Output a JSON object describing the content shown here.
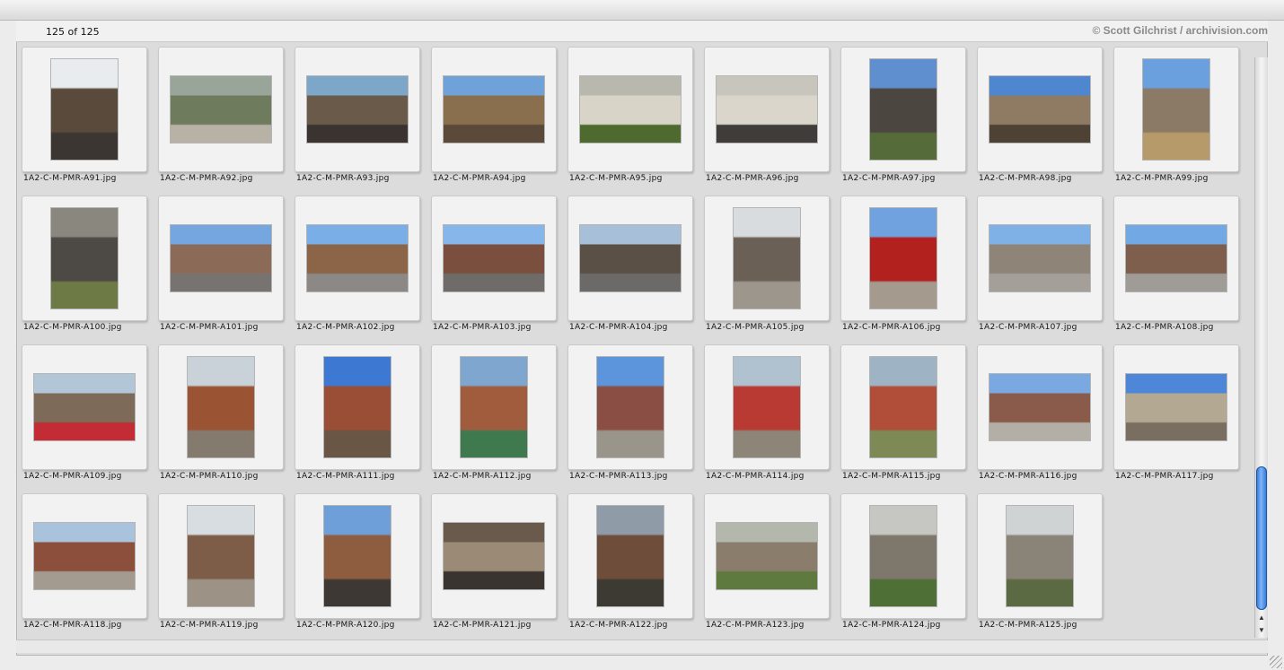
{
  "header": {
    "count": "125 of 125",
    "copyright": "© Scott Gilchrist / archivision.com"
  },
  "thumbnails": [
    {
      "name": "1A2-C-M-PMR-A91.jpg",
      "orient": "port",
      "sky": "#e9ecee",
      "wall": "#5a4a3c",
      "ground": "#3b3632"
    },
    {
      "name": "1A2-C-M-PMR-A92.jpg",
      "orient": "land",
      "sky": "#9aa59a",
      "wall": "#6e7b5c",
      "ground": "#b8b2a6"
    },
    {
      "name": "1A2-C-M-PMR-A93.jpg",
      "orient": "land",
      "sky": "#7da7c9",
      "wall": "#6a5a4a",
      "ground": "#3a3330"
    },
    {
      "name": "1A2-C-M-PMR-A94.jpg",
      "orient": "land",
      "sky": "#6fa2d8",
      "wall": "#8a6f4e",
      "ground": "#5b4a3a"
    },
    {
      "name": "1A2-C-M-PMR-A95.jpg",
      "orient": "land",
      "sky": "#b8b8ae",
      "wall": "#d9d4c8",
      "ground": "#4f6a2f"
    },
    {
      "name": "1A2-C-M-PMR-A96.jpg",
      "orient": "land",
      "sky": "#c8c5bd",
      "wall": "#dad6cc",
      "ground": "#3f3c39"
    },
    {
      "name": "1A2-C-M-PMR-A97.jpg",
      "orient": "port",
      "sky": "#5f8fcf",
      "wall": "#4b4640",
      "ground": "#556b39"
    },
    {
      "name": "1A2-C-M-PMR-A98.jpg",
      "orient": "land",
      "sky": "#4e86d0",
      "wall": "#8f7b63",
      "ground": "#4e4235"
    },
    {
      "name": "1A2-C-M-PMR-A99.jpg",
      "orient": "port",
      "sky": "#6aa0de",
      "wall": "#8a7a66",
      "ground": "#b79a6a"
    },
    {
      "name": "1A2-C-M-PMR-A100.jpg",
      "orient": "port",
      "sky": "#8a877f",
      "wall": "#4d4944",
      "ground": "#6e7a46"
    },
    {
      "name": "1A2-C-M-PMR-A101.jpg",
      "orient": "land",
      "sky": "#76a6e0",
      "wall": "#8b6a58",
      "ground": "#777370"
    },
    {
      "name": "1A2-C-M-PMR-A102.jpg",
      "orient": "land",
      "sky": "#7aaee6",
      "wall": "#8c6447",
      "ground": "#8b8885"
    },
    {
      "name": "1A2-C-M-PMR-A103.jpg",
      "orient": "land",
      "sky": "#86b6ea",
      "wall": "#7a4f3e",
      "ground": "#6e6b69"
    },
    {
      "name": "1A2-C-M-PMR-A104.jpg",
      "orient": "land",
      "sky": "#a7bfd8",
      "wall": "#5a5046",
      "ground": "#6c6a69"
    },
    {
      "name": "1A2-C-M-PMR-A105.jpg",
      "orient": "port",
      "sky": "#d8dcdf",
      "wall": "#6b6055",
      "ground": "#9d968c"
    },
    {
      "name": "1A2-C-M-PMR-A106.jpg",
      "orient": "port",
      "sky": "#6fa2de",
      "wall": "#b3211f",
      "ground": "#a49a8e"
    },
    {
      "name": "1A2-C-M-PMR-A107.jpg",
      "orient": "land",
      "sky": "#80b1e6",
      "wall": "#8e8478",
      "ground": "#a4a099"
    },
    {
      "name": "1A2-C-M-PMR-A108.jpg",
      "orient": "land",
      "sky": "#72a8e4",
      "wall": "#7e5f4e",
      "ground": "#9f9b96"
    },
    {
      "name": "1A2-C-M-PMR-A109.jpg",
      "orient": "land",
      "sky": "#b3c6d8",
      "wall": "#7d6a58",
      "ground": "#c32c34"
    },
    {
      "name": "1A2-C-M-PMR-A110.jpg",
      "orient": "port",
      "sky": "#c9d2d9",
      "wall": "#9a5433",
      "ground": "#857a6e"
    },
    {
      "name": "1A2-C-M-PMR-A111.jpg",
      "orient": "port",
      "sky": "#3d79d2",
      "wall": "#9b4e36",
      "ground": "#6a5644"
    },
    {
      "name": "1A2-C-M-PMR-A112.jpg",
      "orient": "port",
      "sky": "#7ea6cf",
      "wall": "#a05c3d",
      "ground": "#3f7a4f"
    },
    {
      "name": "1A2-C-M-PMR-A113.jpg",
      "orient": "port",
      "sky": "#5c95dc",
      "wall": "#8b4e44",
      "ground": "#9a958b"
    },
    {
      "name": "1A2-C-M-PMR-A114.jpg",
      "orient": "port",
      "sky": "#b0c1cf",
      "wall": "#b83a32",
      "ground": "#8d8678"
    },
    {
      "name": "1A2-C-M-PMR-A115.jpg",
      "orient": "port",
      "sky": "#9eb3c4",
      "wall": "#b04e3a",
      "ground": "#7d8a56"
    },
    {
      "name": "1A2-C-M-PMR-A116.jpg",
      "orient": "land",
      "sky": "#7aa8e0",
      "wall": "#8a5a4a",
      "ground": "#b3aea6"
    },
    {
      "name": "1A2-C-M-PMR-A117.jpg",
      "orient": "land",
      "sky": "#4e86d8",
      "wall": "#b3a892",
      "ground": "#7a6e60"
    },
    {
      "name": "1A2-C-M-PMR-A118.jpg",
      "orient": "land",
      "sky": "#a9c3dd",
      "wall": "#8c4f3c",
      "ground": "#a39b90"
    },
    {
      "name": "1A2-C-M-PMR-A119.jpg",
      "orient": "port",
      "sky": "#d7dde1",
      "wall": "#7d5d48",
      "ground": "#9c9386"
    },
    {
      "name": "1A2-C-M-PMR-A120.jpg",
      "orient": "port",
      "sky": "#6f9fd8",
      "wall": "#8e5d3f",
      "ground": "#3d3833"
    },
    {
      "name": "1A2-C-M-PMR-A121.jpg",
      "orient": "land",
      "sky": "#6a5a4c",
      "wall": "#9a8a76",
      "ground": "#3a3430"
    },
    {
      "name": "1A2-C-M-PMR-A122.jpg",
      "orient": "port",
      "sky": "#8f9ca8",
      "wall": "#6e4d3b",
      "ground": "#3c3a33"
    },
    {
      "name": "1A2-C-M-PMR-A123.jpg",
      "orient": "land",
      "sky": "#b4b8ac",
      "wall": "#8b7d6c",
      "ground": "#5f7a3f"
    },
    {
      "name": "1A2-C-M-PMR-A124.jpg",
      "orient": "port",
      "sky": "#c6c7c2",
      "wall": "#7e776c",
      "ground": "#4e7037"
    },
    {
      "name": "1A2-C-M-PMR-A125.jpg",
      "orient": "port",
      "sky": "#cfd3d4",
      "wall": "#8a8378",
      "ground": "#5c6a43"
    }
  ],
  "scrollbar": {
    "up_arrow": "▲",
    "down_arrow": "▼"
  }
}
